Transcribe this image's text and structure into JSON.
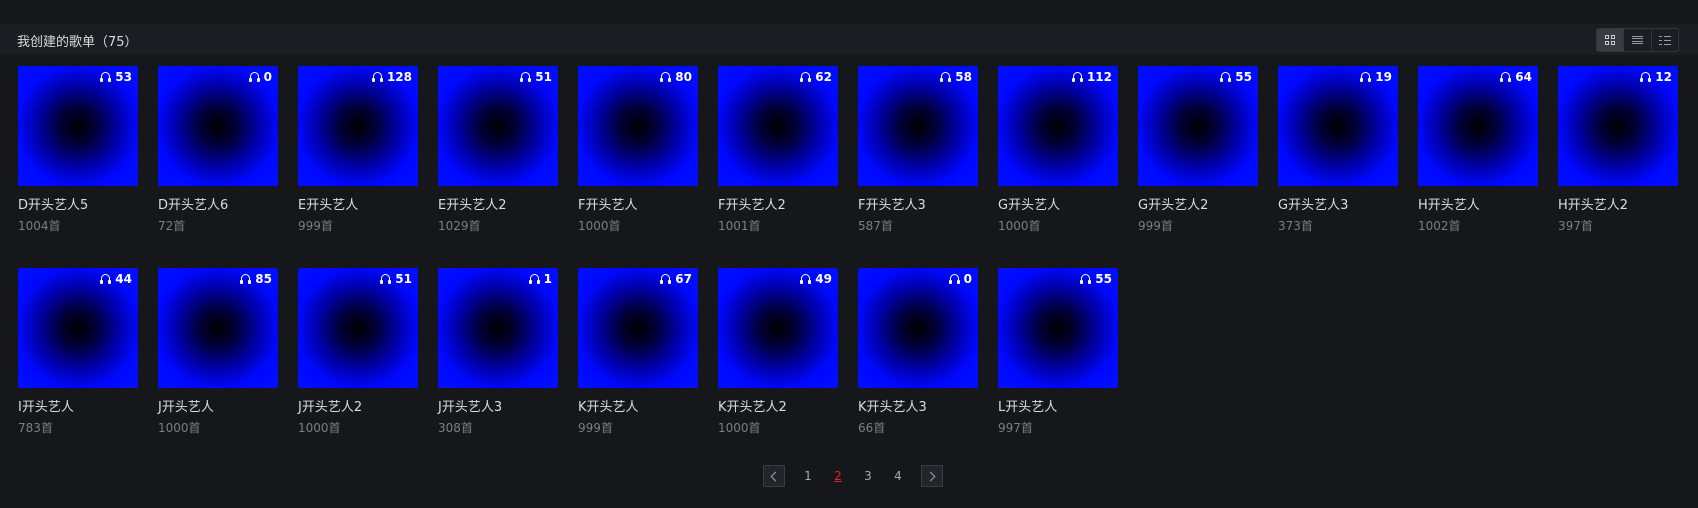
{
  "header": {
    "title": "我创建的歌单（75）",
    "views": [
      {
        "icon": "grid-view-icon",
        "active": true
      },
      {
        "icon": "list-view-icon",
        "active": false
      },
      {
        "icon": "detail-list-view-icon",
        "active": false
      }
    ]
  },
  "playlists": [
    {
      "name": "D开头艺人5",
      "count": "1004首",
      "plays": "53"
    },
    {
      "name": "D开头艺人6",
      "count": "72首",
      "plays": "0"
    },
    {
      "name": "E开头艺人",
      "count": "999首",
      "plays": "128"
    },
    {
      "name": "E开头艺人2",
      "count": "1029首",
      "plays": "51"
    },
    {
      "name": "F开头艺人",
      "count": "1000首",
      "plays": "80"
    },
    {
      "name": "F开头艺人2",
      "count": "1001首",
      "plays": "62"
    },
    {
      "name": "F开头艺人3",
      "count": "587首",
      "plays": "58"
    },
    {
      "name": "G开头艺人",
      "count": "1000首",
      "plays": "112"
    },
    {
      "name": "G开头艺人2",
      "count": "999首",
      "plays": "55"
    },
    {
      "name": "G开头艺人3",
      "count": "373首",
      "plays": "19"
    },
    {
      "name": "H开头艺人",
      "count": "1002首",
      "plays": "64"
    },
    {
      "name": "H开头艺人2",
      "count": "397首",
      "plays": "12"
    },
    {
      "name": "I开头艺人",
      "count": "783首",
      "plays": "44"
    },
    {
      "name": "J开头艺人",
      "count": "1000首",
      "plays": "85"
    },
    {
      "name": "J开头艺人2",
      "count": "1000首",
      "plays": "51"
    },
    {
      "name": "J开头艺人3",
      "count": "308首",
      "plays": "1"
    },
    {
      "name": "K开头艺人",
      "count": "999首",
      "plays": "67"
    },
    {
      "name": "K开头艺人2",
      "count": "1000首",
      "plays": "49"
    },
    {
      "name": "K开头艺人3",
      "count": "66首",
      "plays": "0"
    },
    {
      "name": "L开头艺人",
      "count": "997首",
      "plays": "55"
    }
  ],
  "pagination": {
    "pages": [
      "1",
      "2",
      "3",
      "4"
    ],
    "current": "2"
  },
  "colors": {
    "background": "#16171b",
    "header_bg": "#1c1d22",
    "accent_current_page": "#e0261f",
    "cover_blue": "#0010ff"
  }
}
